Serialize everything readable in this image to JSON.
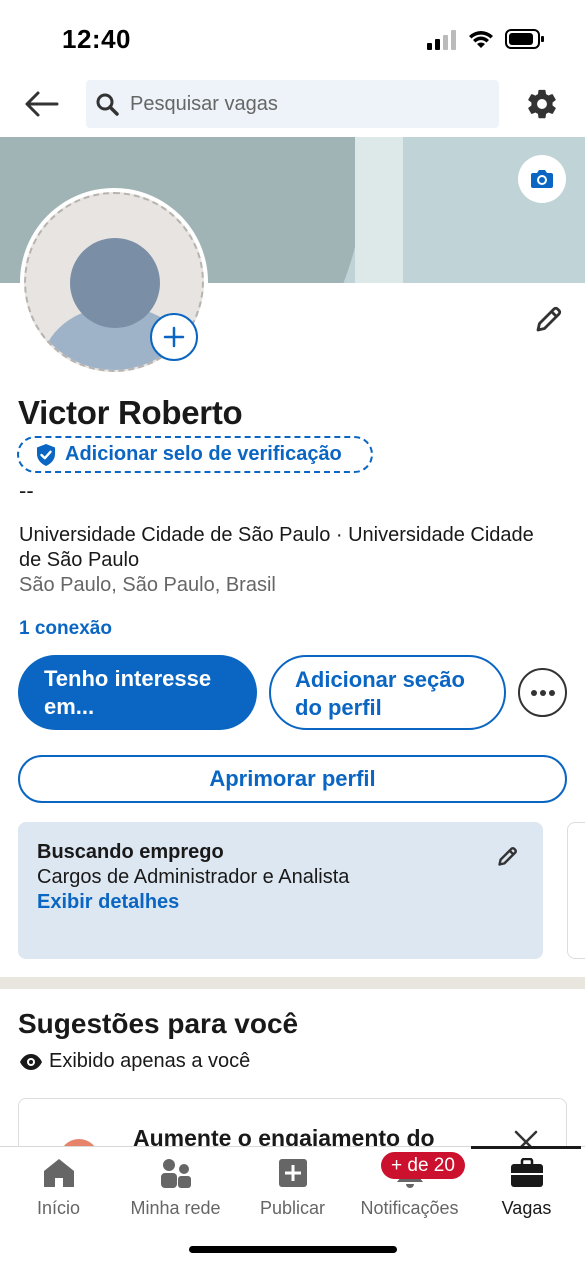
{
  "status_bar": {
    "time": "12:40"
  },
  "topbar": {
    "search_placeholder": "Pesquisar vagas",
    "back_icon": "arrow-left-icon",
    "settings_icon": "gear-icon"
  },
  "profile": {
    "name": "Victor Roberto",
    "verification_label": "Adicionar selo de verificação",
    "headline": "--",
    "education": "Universidade Cidade de São Paulo · Universidade Cidade de São Paulo",
    "location": "São Paulo, São Paulo, Brasil",
    "connections": "1 conexão"
  },
  "actions": {
    "primary": "Tenho interesse em...",
    "secondary": "Adicionar seção do perfil",
    "enhance": "Aprimorar perfil"
  },
  "open_to_work": {
    "title": "Buscando emprego",
    "description": "Cargos de Administrador e Analista",
    "link": "Exibir detalhes"
  },
  "suggestions": {
    "title": "Sugestões para você",
    "visibility": "Exibido apenas a você",
    "card_text": "Aumente o engajamento do"
  },
  "bottom_nav": {
    "items": [
      {
        "label": "Início",
        "icon": "home-icon"
      },
      {
        "label": "Minha rede",
        "icon": "network-icon"
      },
      {
        "label": "Publicar",
        "icon": "plus-square-icon"
      },
      {
        "label": "Notificações",
        "icon": "bell-icon"
      },
      {
        "label": "Vagas",
        "icon": "briefcase-icon"
      }
    ],
    "notification_badge": "+ de 20",
    "active": "Vagas"
  },
  "colors": {
    "accent": "#0a66c2",
    "badge": "#cb112d",
    "card_bg": "#dde7f1"
  }
}
